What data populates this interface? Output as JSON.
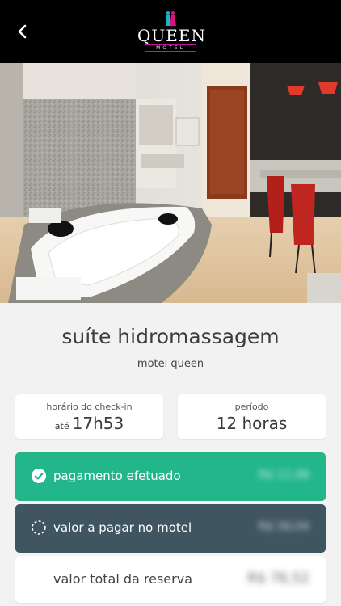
{
  "header": {
    "logo_text": "QUEEN",
    "logo_sub": "MOTEL"
  },
  "suite": {
    "name": "suíte hidromassagem",
    "motel": "motel queen"
  },
  "checkin": {
    "label": "horário do check-in",
    "prefix": "até",
    "time": "17h53"
  },
  "periodo": {
    "label": "período",
    "value": "12 horas"
  },
  "payment": {
    "paid_label": "pagamento efetuado",
    "paid_amount": "R$ 11,48",
    "due_label": "valor a pagar no motel",
    "due_amount": "R$ 56,04",
    "total_label": "valor total da reserva",
    "total_amount": "R$ 76,52"
  },
  "colors": {
    "paid": "#22b68a",
    "due": "#3f5560",
    "logo_accent": "#c0179b"
  }
}
